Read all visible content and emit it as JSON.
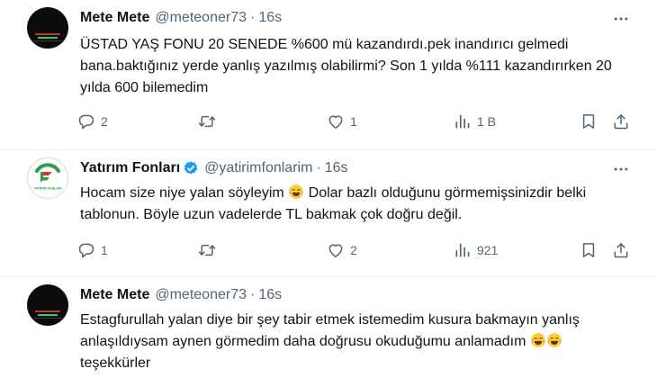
{
  "tweets": [
    {
      "name": "Mete Mete",
      "handle": "@meteoner73",
      "dot": "·",
      "time": "16s",
      "text": "ÜSTAD YAŞ FONU 20 SENEDE %600 mü kazandırdı.pek inandırıcı gelmedi bana.baktığınız yerde yanlış yazılmış olabilirmi? Son 1 yılda %111 kazandırırken 20 yılda 600 bilemedim",
      "replies": "2",
      "retweets": "",
      "likes": "1",
      "views": "1 B"
    },
    {
      "name": "Yatırım Fonları",
      "handle": "@yatirimfonlarim",
      "dot": "·",
      "time": "16s",
      "text_a": "Hocam size niye yalan söyleyim ",
      "text_b": " Dolar bazlı olduğunu görmemişsinizdir belki tablonun. Böyle uzun vadelerde TL bakmak çok doğru değil.",
      "avatar_label": "YATIRIM FONLARI",
      "replies": "1",
      "retweets": "",
      "likes": "2",
      "views": "921"
    },
    {
      "name": "Mete Mete",
      "handle": "@meteoner73",
      "dot": "·",
      "time": "16s",
      "text_a": "Estagfurullah yalan diye bir şey tabir etmek istemedim kusura bakmayın yanlış anlaşıldıysam aynen görmedim daha doğrusu okuduğumu anlamadım ",
      "text_b": "teşekkürler"
    }
  ],
  "icons": {
    "reply": "reply-icon",
    "retweet": "retweet-icon",
    "like": "heart-icon",
    "views": "views-icon",
    "bookmark": "bookmark-icon",
    "share": "share-icon",
    "more": "more-icon",
    "verified": "verified-badge-icon",
    "emoji": "tears-of-joy-emoji"
  },
  "colors": {
    "text": "#0f1419",
    "secondary": "#536471",
    "verified": "#1d9bf0",
    "logo_green": "#2e9e4a",
    "logo_red": "#d9342b"
  }
}
